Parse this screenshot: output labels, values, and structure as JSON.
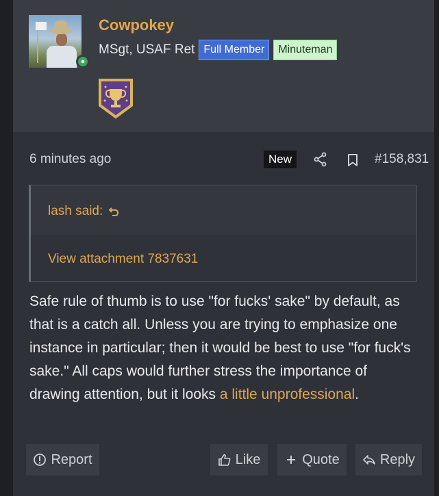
{
  "user": {
    "name": "Cowpokey",
    "title": "MSgt, USAF Ret",
    "banners": [
      "Full Member",
      "Minuteman"
    ]
  },
  "post": {
    "time": "6 minutes ago",
    "new_badge": "New",
    "number": "#158,831"
  },
  "quote": {
    "author": "lash said:",
    "attachment_link": "View attachment 7837631"
  },
  "message": {
    "text_before_link": "Safe rule of thumb is to use \"for fucks' sake\" by default, as that is a catch all. Unless you are trying to emphasize one instance in particular; then it would be best to use \"for fuck's sake.\" All caps would further stress the importance of drawing attention, but it looks ",
    "link_text": "a little unprofessional",
    "text_after_link": "."
  },
  "actions": {
    "report": "Report",
    "like": "Like",
    "quote": "Quote",
    "reply": "Reply"
  },
  "colors": {
    "accent": "#e0a553",
    "full_member_banner": "#3f6bd6",
    "minuteman_banner": "#ccf5cc",
    "online": "#3aa85a"
  },
  "icons": [
    "share-icon",
    "bookmark-icon",
    "quote-jump-icon",
    "report-icon",
    "thumbs-up-icon",
    "plus-icon",
    "reply-icon",
    "trophy-icon",
    "online-status-icon"
  ]
}
